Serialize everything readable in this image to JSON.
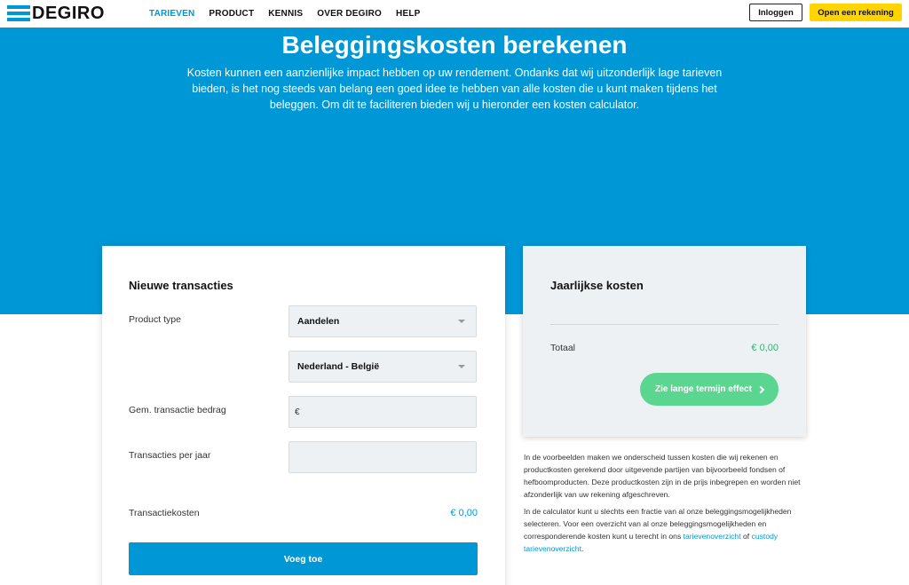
{
  "header": {
    "logo_text": "DEGIRO",
    "nav": [
      {
        "label": "TARIEVEN",
        "active": true
      },
      {
        "label": "PRODUCT",
        "active": false
      },
      {
        "label": "KENNIS",
        "active": false
      },
      {
        "label": "OVER DEGIRO",
        "active": false
      },
      {
        "label": "HELP",
        "active": false
      }
    ],
    "login_label": "Inloggen",
    "open_account_label": "Open een rekening"
  },
  "hero": {
    "title": "Beleggingskosten berekenen",
    "text": "Kosten kunnen een aanzienlijke impact hebben op uw rendement. Ondanks dat wij uitzonderlijk lage tarieven bieden, is het nog steeds van belang een goed idee te hebben van alle kosten die u kunt maken tijdens het beleggen. Om dit te faciliteren bieden wij u hieronder een kosten calculator."
  },
  "calculator": {
    "title": "Nieuwe transacties",
    "product_type_label": "Product type",
    "product_type_value": "Aandelen",
    "exchange_value": "Nederland - België",
    "amount_label": "Gem. transactie bedrag",
    "amount_currency": "€",
    "amount_value": "",
    "transactions_label": "Transacties per jaar",
    "transactions_value": "",
    "cost_label": "Transactiekosten",
    "cost_value": "€ 0,00",
    "add_button": "Voeg toe"
  },
  "annual": {
    "title": "Jaarlijkse kosten",
    "total_label": "Totaal",
    "total_value": "€ 0,00",
    "long_term_button": "Zie lange termijn effect"
  },
  "info": {
    "paragraph1": "In de voorbeelden maken we onderscheid tussen kosten die wij rekenen en productkosten gerekend door uitgevende partijen van bijvoorbeeld fondsen of hefboomproducten. Deze productkosten zijn in de prijs inbegrepen en worden niet afzonderlijk van uw rekening afgeschreven.",
    "paragraph2_text": "In de calculator kunt u slechts een fractie van al onze beleggingsmogelijkheden selecteren. Voor een overzicht van al onze beleggingsmogelijkheden en corresponderende kosten kunt u terecht in ons",
    "link1": "tarievenoverzicht",
    "connector": "of",
    "link2": "custody tarievenoverzicht",
    "end": "."
  },
  "colors": {
    "brand_blue": "#0097d7",
    "accent_yellow": "#ffd400",
    "accent_green": "#5ad691",
    "total_green": "#2bb673"
  }
}
